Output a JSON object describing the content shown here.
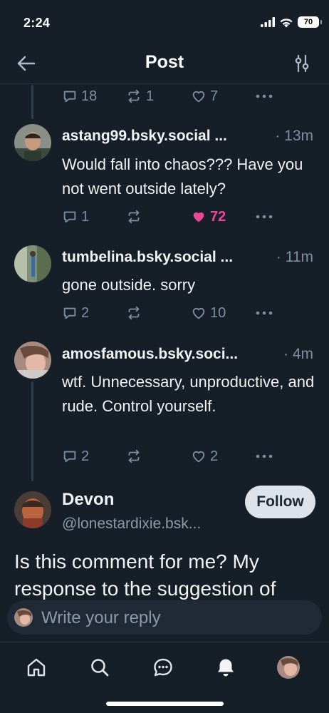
{
  "status": {
    "time": "2:24",
    "battery": "70"
  },
  "header": {
    "title": "Post"
  },
  "top_actions": {
    "replies": "18",
    "reposts": "1",
    "likes": "7"
  },
  "replies": [
    {
      "handle": "astang99.bsky.social ...",
      "time": "· 13m",
      "text": "Would fall into chaos??? Have you not went outside lately?",
      "replies": "1",
      "reposts": "",
      "likes": "72",
      "liked": true
    },
    {
      "handle": "tumbelina.bsky.social ...",
      "time": "· 11m",
      "text": "gone outside. sorry",
      "replies": "2",
      "reposts": "",
      "likes": "10",
      "liked": false
    },
    {
      "handle": "amosfamous.bsky.soci...",
      "time": "· 4m",
      "text": "wtf.  Unnecessary, unproductive, and rude. Control yourself.",
      "replies": "2",
      "reposts": "",
      "likes": "2",
      "liked": false
    }
  ],
  "focused_post": {
    "display_name": "Devon",
    "handle": "@lonestardixie.bsk...",
    "follow_label": "Follow",
    "text": "Is this comment for me? My response to the suggestion of"
  },
  "composer": {
    "placeholder": "Write your reply"
  },
  "colors": {
    "background": "#161e27",
    "like": "#ec4899",
    "muted": "#7f8fa3",
    "follow_bg": "#dce3ea"
  },
  "tabs": [
    "home-icon",
    "search-icon",
    "chat-icon",
    "notifications-icon",
    "profile-avatar"
  ]
}
